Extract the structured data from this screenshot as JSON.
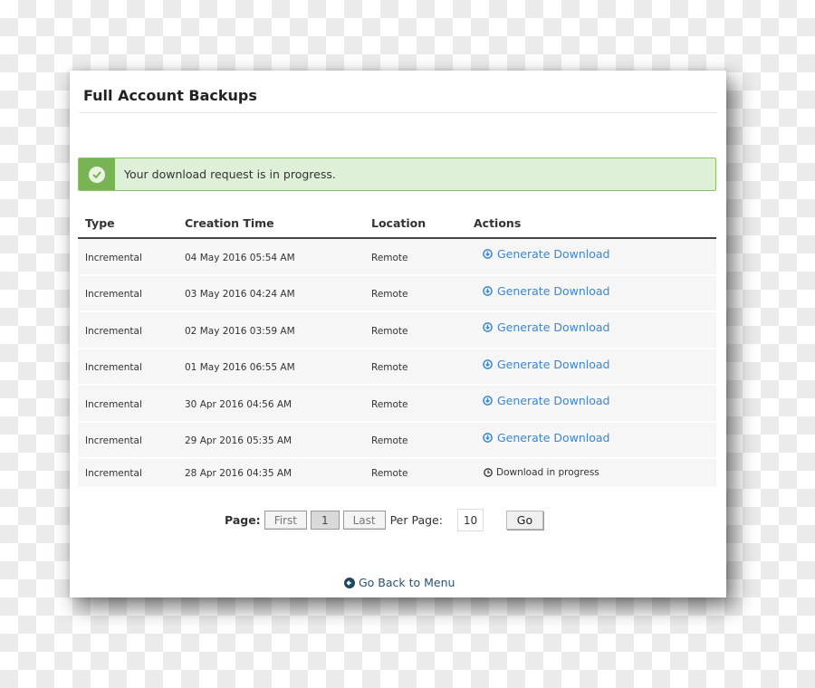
{
  "page": {
    "title": "Full Account Backups"
  },
  "alert": {
    "icon": "check-circle-icon",
    "message": "Your download request is in progress.",
    "color": "#78b454"
  },
  "table": {
    "headers": {
      "type": "Type",
      "creation_time": "Creation Time",
      "location": "Location",
      "actions": "Actions"
    },
    "rows": [
      {
        "type": "Incremental",
        "creation_time": "04 May 2016 05:54 AM",
        "location": "Remote",
        "action": "Generate Download",
        "action_kind": "link"
      },
      {
        "type": "Incremental",
        "creation_time": "03 May 2016 04:24 AM",
        "location": "Remote",
        "action": "Generate Download",
        "action_kind": "link"
      },
      {
        "type": "Incremental",
        "creation_time": "02 May 2016 03:59 AM",
        "location": "Remote",
        "action": "Generate Download",
        "action_kind": "link"
      },
      {
        "type": "Incremental",
        "creation_time": "01 May 2016 06:55 AM",
        "location": "Remote",
        "action": "Generate Download",
        "action_kind": "link"
      },
      {
        "type": "Incremental",
        "creation_time": "30 Apr 2016 04:56 AM",
        "location": "Remote",
        "action": "Generate Download",
        "action_kind": "link"
      },
      {
        "type": "Incremental",
        "creation_time": "29 Apr 2016 05:35 AM",
        "location": "Remote",
        "action": "Generate Download",
        "action_kind": "link"
      },
      {
        "type": "Incremental",
        "creation_time": "28 Apr 2016 04:35 AM",
        "location": "Remote",
        "action": "Download in progress",
        "action_kind": "status"
      }
    ],
    "link_color": "#3d86cc"
  },
  "pagination": {
    "label": "Page:",
    "first": "First",
    "current": "1",
    "last": "Last",
    "per_page_label": "Per Page:",
    "per_page_value": "10",
    "go": "Go"
  },
  "footer": {
    "back_link": "Go Back to Menu"
  }
}
